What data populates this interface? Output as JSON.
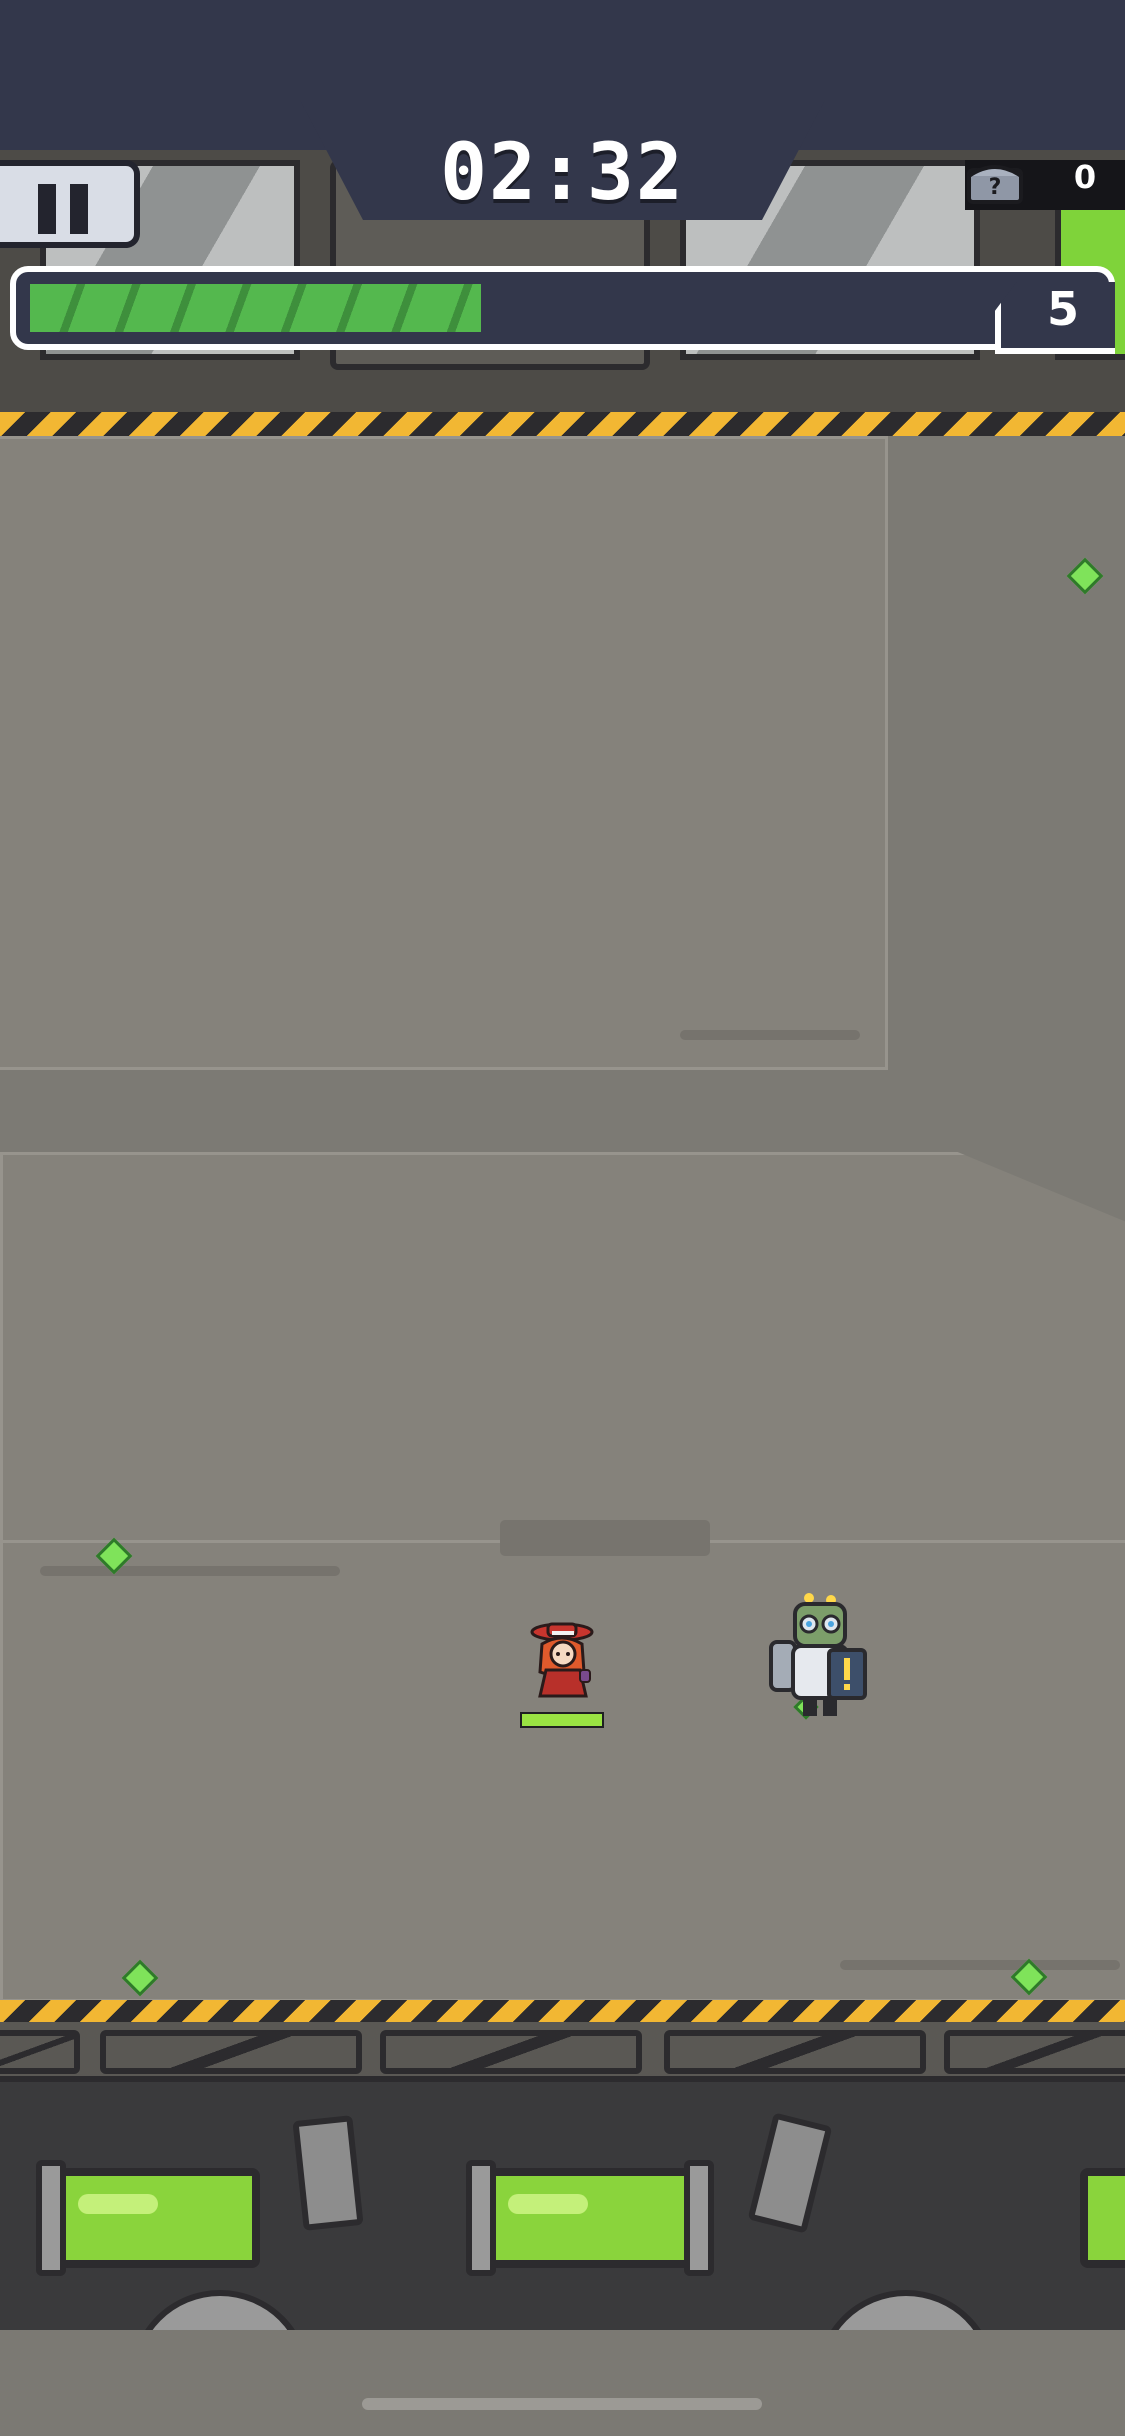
{
  "hud": {
    "timer": "02:32",
    "chest_count": "0",
    "chest_icon_mark": "?",
    "level": "5",
    "xp_progress_percent": 46
  },
  "icons": {
    "pause": "pause-icon",
    "chest": "chest-icon",
    "gem": "gem-icon"
  },
  "colors": {
    "hud_background": "#33374b",
    "xp_bar": "#54b84e",
    "gem": "#7fe35a",
    "hero_hp": "#9ae343",
    "hazard_stripe": "#f2b733"
  },
  "player": {
    "hp_percent": 100
  },
  "gem_count_on_field": 6
}
